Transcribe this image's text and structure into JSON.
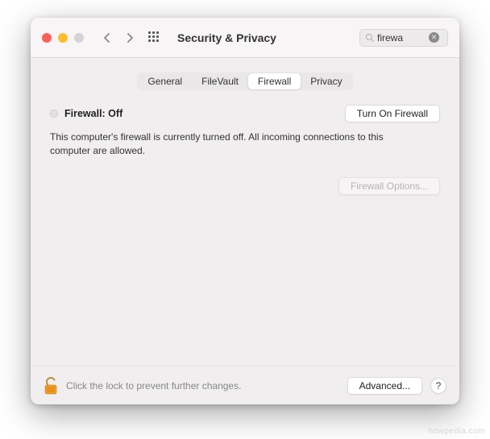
{
  "window": {
    "title": "Security & Privacy"
  },
  "search": {
    "value": "firewa",
    "placeholder": "Search"
  },
  "tabs": {
    "items": [
      {
        "label": "General"
      },
      {
        "label": "FileVault"
      },
      {
        "label": "Firewall"
      },
      {
        "label": "Privacy"
      }
    ],
    "active_index": 2
  },
  "firewall": {
    "status_label": "Firewall: Off",
    "turn_on_label": "Turn On Firewall",
    "description": "This computer's firewall is currently turned off. All incoming connections to this computer are allowed.",
    "options_label": "Firewall Options...",
    "options_enabled": false
  },
  "footer": {
    "lock_text": "Click the lock to prevent further changes.",
    "advanced_label": "Advanced...",
    "help_label": "?"
  },
  "watermark": "howpedia.com"
}
